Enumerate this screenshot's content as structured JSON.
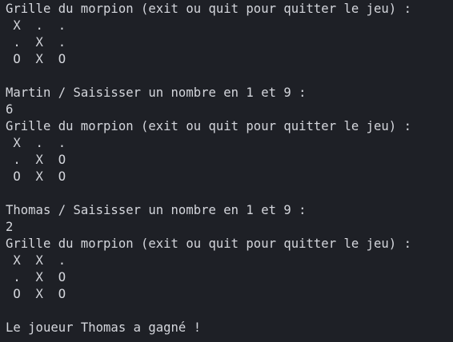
{
  "terminal": {
    "lines": [
      "Grille du morpion (exit ou quit pour quitter le jeu) :",
      " X  .  .",
      " .  X  .",
      " O  X  O",
      "",
      "Martin / Saisisser un nombre en 1 et 9 :",
      "6",
      "Grille du morpion (exit ou quit pour quitter le jeu) :",
      " X  .  .",
      " .  X  O",
      " O  X  O",
      "",
      "Thomas / Saisisser un nombre en 1 et 9 :",
      "2",
      "Grille du morpion (exit ou quit pour quitter le jeu) :",
      " X  X  .",
      " .  X  O",
      " O  X  O",
      "",
      "Le joueur Thomas a gagné !"
    ]
  },
  "colors": {
    "background": "#1e2026",
    "text": "#d4d6dc"
  }
}
